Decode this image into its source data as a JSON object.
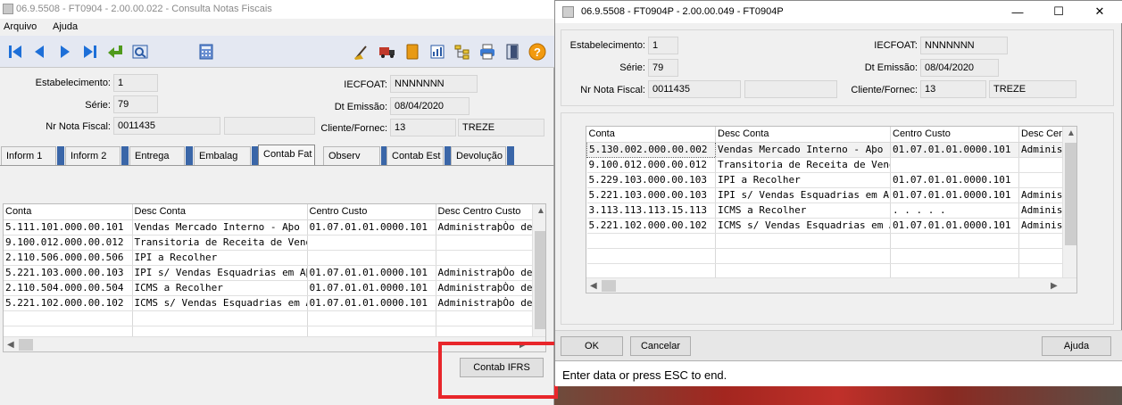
{
  "main": {
    "title": "06.9.5508 - FT0904 - 2.00.00.022 - Consulta Notas Fiscais",
    "menu": [
      "Arquivo",
      "Ajuda"
    ],
    "toolbar_icons": [
      "first-record-icon",
      "prev-record-icon",
      "next-record-icon",
      "last-record-icon",
      "return-icon",
      "zoom-icon",
      "calculator-icon",
      "cleaning-icon",
      "truck-icon",
      "book-icon",
      "chart-icon",
      "tree-icon",
      "print-icon",
      "exit-door-icon",
      "help-icon"
    ],
    "fields": {
      "estabelecimento_label": "Estabelecimento:",
      "estabelecimento": "1",
      "serie_label": "Série:",
      "serie": "79",
      "nr_nota_label": "Nr Nota Fiscal:",
      "nr_nota": "0011435",
      "iecfoat_label": "IECFOAT:",
      "iecfoat": "NNNNNNN",
      "dt_emissao_label": "Dt Emissão:",
      "dt_emissao": "08/04/2020",
      "cliente_label": "Cliente/Fornec:",
      "cliente_code": "13",
      "cliente_name": "TREZE"
    },
    "tabs": [
      "Inform 1",
      "Inform 2",
      "Entrega",
      "Embalag",
      "Contab Fat",
      "Observ",
      "Contab Est",
      "Devolução"
    ],
    "grid": {
      "headers": [
        "Conta",
        "Desc Conta",
        "Centro Custo",
        "Desc Centro Custo"
      ],
      "rows": [
        [
          "5.111.101.000.00.101",
          "Vendas Mercado Interno - Aþo",
          "01.07.01.01.0000.101",
          "AdministraþÒo de"
        ],
        [
          "9.100.012.000.00.012",
          "Transitoria de Receita de Vendas",
          "",
          ""
        ],
        [
          "2.110.506.000.00.506",
          "IPI a Recolher",
          "",
          ""
        ],
        [
          "5.221.103.000.00.103",
          "IPI s/ Vendas Esquadrias em Aþo",
          "01.07.01.01.0000.101",
          "AdministraþÒo de"
        ],
        [
          "2.110.504.000.00.504",
          "ICMS a Recolher",
          "01.07.01.01.0000.101",
          "AdministraþÒo de"
        ],
        [
          "5.221.102.000.00.102",
          "ICMS s/ Vendas Esquadrias em Al",
          "01.07.01.01.0000.101",
          "AdministraþÒo de"
        ]
      ]
    },
    "contab_ifrs_label": "Contab IFRS"
  },
  "dialog": {
    "title": "06.9.5508 - FT0904P - 2.00.00.049 - FT0904P",
    "fields": {
      "estabelecimento_label": "Estabelecimento:",
      "estabelecimento": "1",
      "serie_label": "Série:",
      "serie": "79",
      "nr_nota_label": "Nr Nota Fiscal:",
      "nr_nota": "0011435",
      "iecfoat_label": "IECFOAT:",
      "iecfoat": "NNNNNNN",
      "dt_emissao_label": "Dt Emissão:",
      "dt_emissao": "08/04/2020",
      "cliente_label": "Cliente/Fornec:",
      "cliente_code": "13",
      "cliente_name": "TREZE"
    },
    "grid": {
      "headers": [
        "Conta",
        "Desc Conta",
        "Centro Custo",
        "Desc Cent"
      ],
      "rows": [
        [
          "5.130.002.000.00.002",
          "Vendas Mercado Interno - Aþo",
          "01.07.01.01.0000.101",
          "Administ"
        ],
        [
          "9.100.012.000.00.012",
          "Transitoria de Receita de Vendas",
          "",
          ""
        ],
        [
          "5.229.103.000.00.103",
          "IPI a Recolher",
          "01.07.01.01.0000.101",
          ""
        ],
        [
          "5.221.103.000.00.103",
          "IPI s/ Vendas Esquadrias em Aþo",
          "01.07.01.01.0000.101",
          "Administ"
        ],
        [
          "3.113.113.113.15.113",
          "ICMS a Recolher",
          " .  .  .  .  .",
          "Administ"
        ],
        [
          "5.221.102.000.00.102",
          "ICMS s/ Vendas Esquadrias em Al",
          "01.07.01.01.0000.101",
          "Administ"
        ]
      ]
    },
    "ok_label": "OK",
    "cancel_label": "Cancelar",
    "help_label": "Ajuda",
    "status_text": "Enter data or press ESC to end."
  }
}
